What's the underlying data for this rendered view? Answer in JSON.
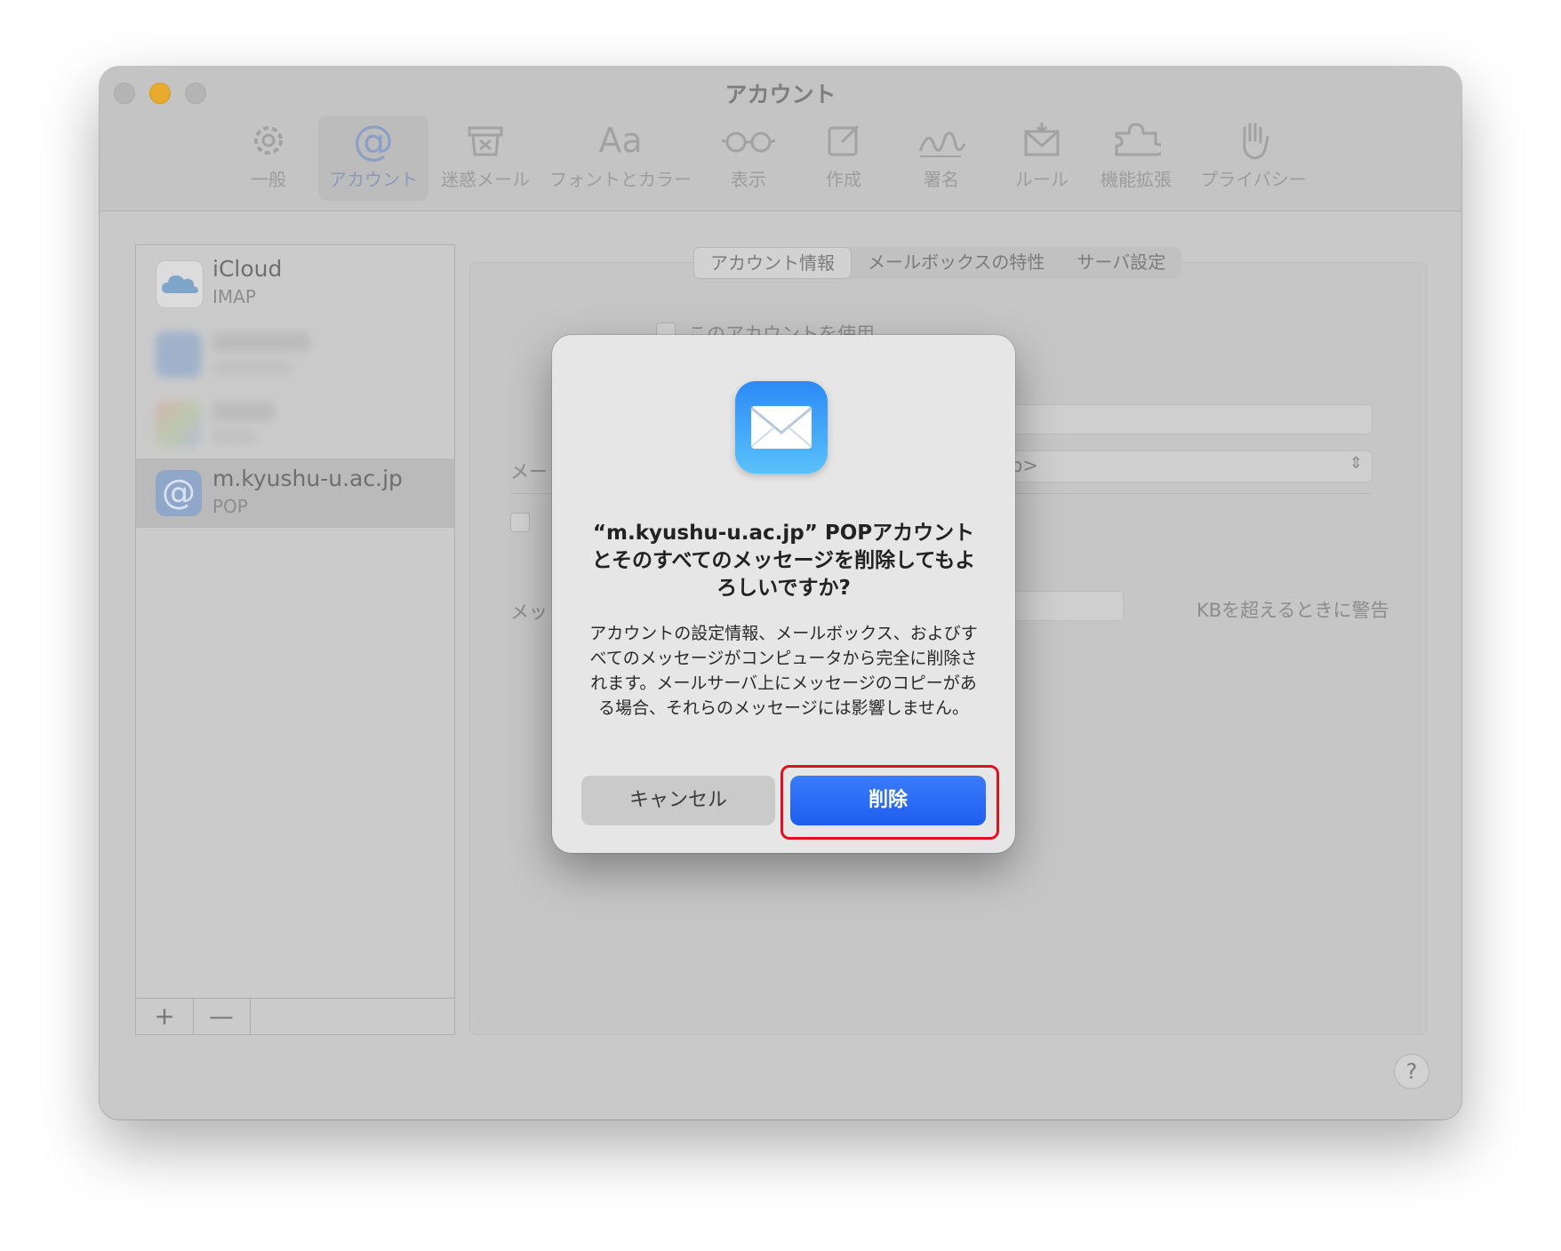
{
  "window": {
    "title": "アカウント",
    "toolbar": [
      {
        "label": "一般",
        "icon": "gear-icon"
      },
      {
        "label": "アカウント",
        "icon": "at-icon"
      },
      {
        "label": "迷惑メール",
        "icon": "junk-tray-icon"
      },
      {
        "label": "フォントとカラー",
        "icon": "fonts-icon",
        "glyph": "Aa"
      },
      {
        "label": "表示",
        "icon": "glasses-icon"
      },
      {
        "label": "作成",
        "icon": "compose-icon"
      },
      {
        "label": "署名",
        "icon": "signature-icon"
      },
      {
        "label": "ルール",
        "icon": "rules-icon"
      },
      {
        "label": "機能拡張",
        "icon": "puzzle-icon"
      },
      {
        "label": "プライバシー",
        "icon": "hand-icon"
      }
    ],
    "active_tab": "アカウント"
  },
  "sidebar": {
    "accounts": [
      {
        "name": "iCloud",
        "type": "IMAP",
        "icon": "icloud-icon"
      },
      {
        "name": "",
        "type": "",
        "icon": "exchange-icon",
        "blurred": true
      },
      {
        "name": "",
        "type": "",
        "icon": "google-icon",
        "blurred": true
      },
      {
        "name": "m.kyushu-u.ac.jp",
        "type": "POP",
        "icon": "at-icon",
        "selected": true
      }
    ],
    "add_label": "+",
    "remove_label": "—"
  },
  "tabs": [
    "アカウント情報",
    "メールボックスの特性",
    "サーバ設定"
  ],
  "background_form": {
    "use_account": "このアカウントを使用",
    "mail_label_fragment": "メー",
    "address_fragment": "shu-u.ac.jp>",
    "msg_label_fragment": "メッ",
    "size_warning": "KBを超えるときに警告",
    "help": "?"
  },
  "dialog": {
    "icon": "mail-icon",
    "title": "“m.kyushu-u.ac.jp” POPアカウントとそのすべてのメッセージを削除してもよろしいですか?",
    "message": "アカウントの設定情報、メールボックス、およびすべてのメッセージがコンピュータから完全に削除されます。メールサーバ上にメッセージのコピーがある場合、それらのメッセージには影響しません。",
    "cancel_label": "キャンセル",
    "delete_label": "削除"
  },
  "colors": {
    "delete_button": "#2563f2",
    "highlight": "#e0111e",
    "window_dimmed": "#c9c9c9"
  }
}
